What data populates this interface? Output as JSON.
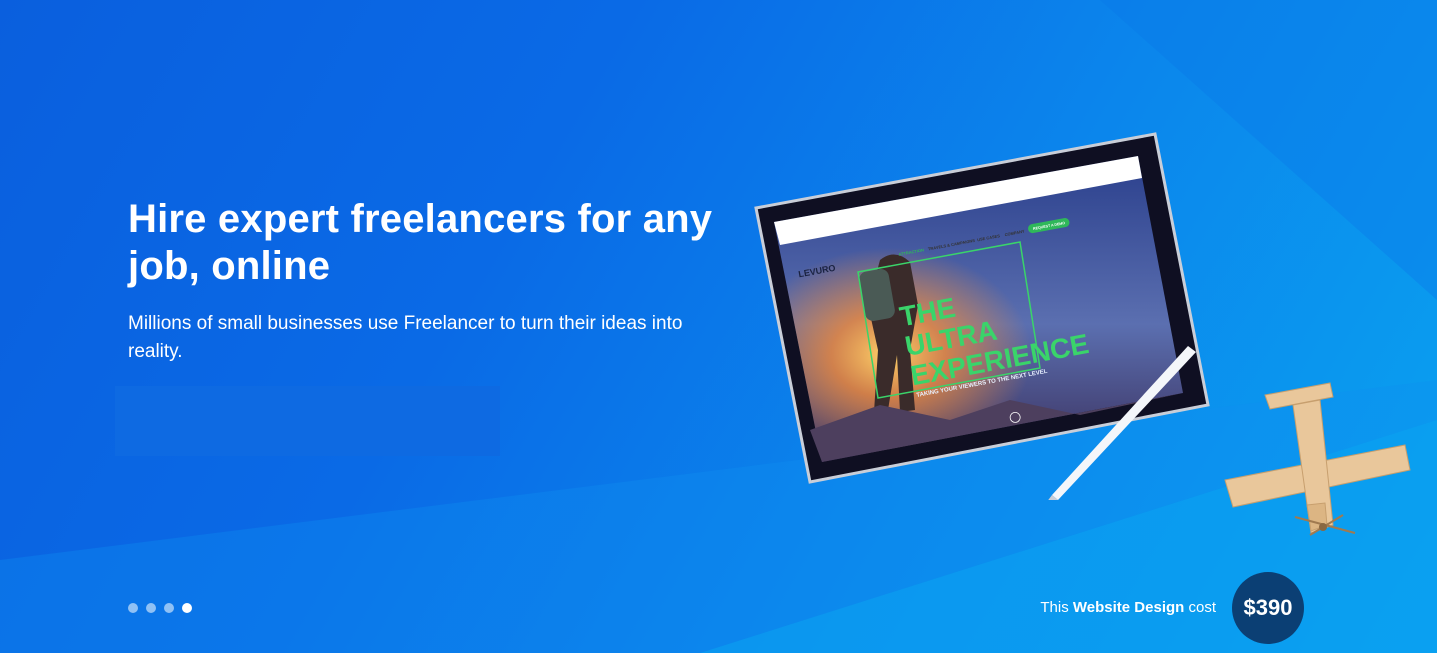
{
  "hero": {
    "title": "Hire expert freelancers for any job, online",
    "subtitle": "Millions of small businesses use Freelancer to turn their ideas into reality."
  },
  "carousel": {
    "dot_count": 4,
    "active_index": 3
  },
  "showcase": {
    "caption_prefix": "This",
    "caption_emphasis": "Website Design",
    "caption_suffix": "cost",
    "price": "$390",
    "tablet_screen": {
      "brand": "LEVURO",
      "headline_1": "THE",
      "headline_2": "ULTRA",
      "headline_3": "EXPERIENCE",
      "tagline": "TAKING YOUR VIEWERS TO THE NEXT LEVEL",
      "nav_1": "ATTRACTION",
      "nav_2": "TRAVELS & CAMPAIGNS",
      "nav_3": "USE CASES",
      "nav_4": "COMPANY",
      "nav_cta": "REQUEST A DEMO"
    }
  },
  "colors": {
    "background_start": "#0a5fde",
    "background_end": "#0aa3f0",
    "badge": "#0b3f74",
    "accent_green": "#3ad46a"
  }
}
